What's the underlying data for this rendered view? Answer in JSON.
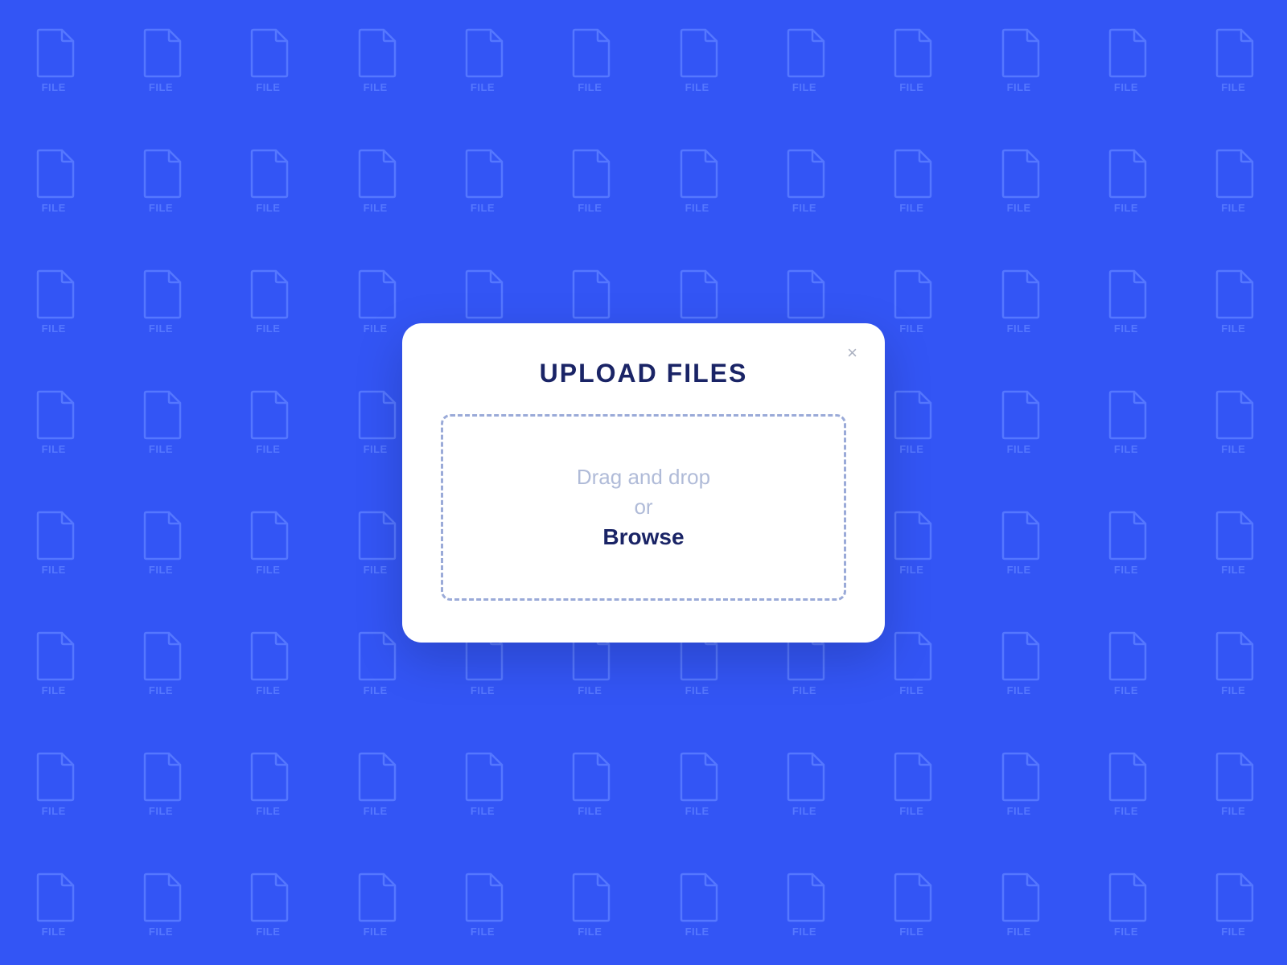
{
  "background": {
    "color": "#3355f5",
    "file_label": "FILE",
    "rows": 8,
    "cols": 12
  },
  "modal": {
    "title": "UPLOAD FILES",
    "close_label": "×",
    "dropzone": {
      "drag_text": "Drag and drop",
      "or_text": "or",
      "browse_text": "Browse"
    }
  }
}
